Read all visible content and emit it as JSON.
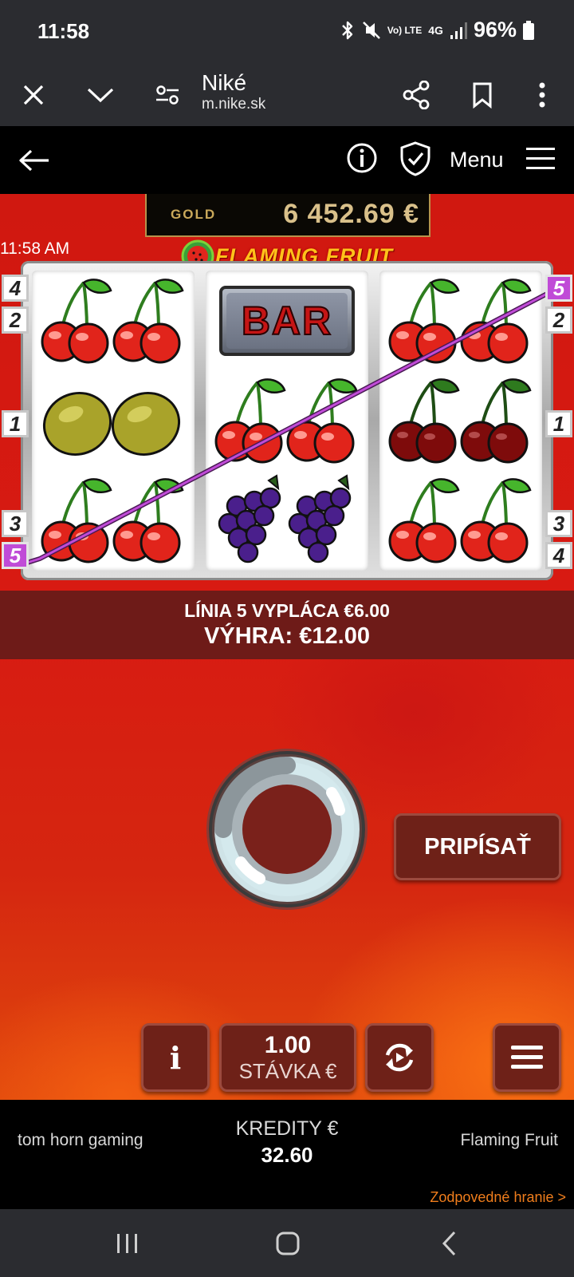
{
  "status_bar": {
    "time": "11:58",
    "network": "Vo) LTE",
    "network_type": "4G",
    "battery": "96%",
    "icons": [
      "bluetooth-icon",
      "mute-icon",
      "volte-icon",
      "4g-icon",
      "signal-icon",
      "battery-icon"
    ]
  },
  "browser": {
    "title": "Niké",
    "url": "m.nike.sk",
    "icons": [
      "close-icon",
      "chevron-down-icon",
      "site-settings-icon",
      "share-icon",
      "bookmark-icon",
      "more-vert-icon"
    ]
  },
  "site_header": {
    "menu_label": "Menu",
    "icons": [
      "back-arrow-icon",
      "info-icon",
      "shield-check-icon",
      "hamburger-icon"
    ]
  },
  "game": {
    "balance_label": "GOLD",
    "balance_amount": "6 452.69 €",
    "clock": "11:58 AM",
    "logo_text": "FLAMING FRUIT",
    "reels": [
      [
        "cherries",
        "lemons",
        "cherries"
      ],
      [
        "bar",
        "cherries",
        "grapes"
      ],
      [
        "cherries",
        "dark-cherries",
        "cherries"
      ]
    ],
    "bar_symbol_text": "BAR",
    "left_line_tags": [
      "4",
      "2",
      "1",
      "3",
      "5"
    ],
    "right_line_tags": [
      "5",
      "2",
      "1",
      "3",
      "4"
    ],
    "active_line": "5",
    "win_line_text": "LÍNIA 5 VYPLÁCA €6.00",
    "win_total_text": "VÝHRA: €12.00",
    "collect_button": "PRIPÍSAŤ",
    "info_button": "i",
    "stake_value": "1.00",
    "stake_label": "STÁVKA €",
    "colors": {
      "background": "#d01810",
      "panel": "#6e1b18",
      "button": "#6e2118",
      "gold": "#d9c08a",
      "line": "#c04bd7"
    }
  },
  "footer": {
    "provider": "tom horn gaming",
    "credits_label": "KREDITY €",
    "credits_value": "32.60",
    "game_name": "Flaming Fruit",
    "responsible_link": "Zodpovedné hranie >",
    "link_color": "#ef7d1c"
  },
  "nav_bar": {
    "icons": [
      "recent-apps-icon",
      "home-icon",
      "back-icon"
    ]
  }
}
